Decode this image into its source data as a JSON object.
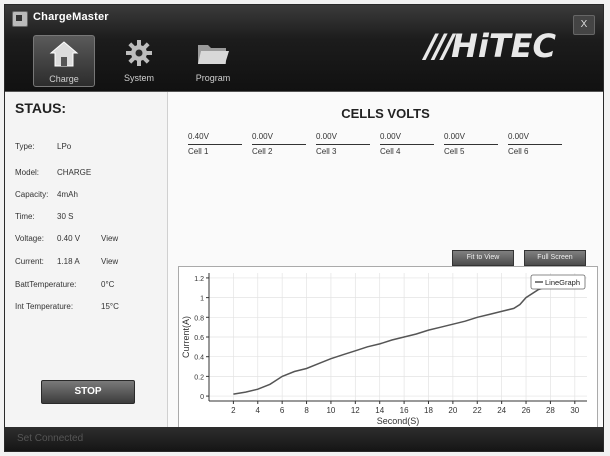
{
  "window": {
    "title": "ChargeMaster",
    "close_label": "X"
  },
  "toolbar": {
    "items": [
      {
        "label": "Charge",
        "icon": "house-icon"
      },
      {
        "label": "System",
        "icon": "gear-icon"
      },
      {
        "label": "Program",
        "icon": "folder-icon"
      }
    ]
  },
  "brand": {
    "logo_text": "HiTEC"
  },
  "status": {
    "heading": "STAUS:",
    "rows": [
      {
        "label": "Type:",
        "value": "LPo",
        "link": ""
      },
      {
        "label": "Model:",
        "value": "CHARGE",
        "link": ""
      },
      {
        "label": "Capacity:",
        "value": "4mAh",
        "link": ""
      },
      {
        "label": "Time:",
        "value": "30 S",
        "link": ""
      },
      {
        "label": "Voltage:",
        "value": "0.40 V",
        "link": "View"
      },
      {
        "label": "Current:",
        "value": "1.18 A",
        "link": "View"
      },
      {
        "label": "BattTemperature:",
        "value": "0°C",
        "link": ""
      },
      {
        "label": "Int Temperature:",
        "value": "15°C",
        "link": ""
      }
    ],
    "stop_label": "STOP"
  },
  "cells": {
    "title": "CELLS VOLTS",
    "items": [
      {
        "volt": "0.40V",
        "name": "Cell 1"
      },
      {
        "volt": "0.00V",
        "name": "Cell 2"
      },
      {
        "volt": "0.00V",
        "name": "Cell 3"
      },
      {
        "volt": "0.00V",
        "name": "Cell 4"
      },
      {
        "volt": "0.00V",
        "name": "Cell 5"
      },
      {
        "volt": "0.00V",
        "name": "Cell 6"
      }
    ]
  },
  "graph_buttons": {
    "fit_label": "Fit to View",
    "full_label": "Full Screen"
  },
  "chart_data": {
    "type": "line",
    "title": "",
    "xlabel": "Second(S)",
    "ylabel": "Current(A)",
    "xlim": [
      0,
      31
    ],
    "ylim": [
      -0.05,
      1.25
    ],
    "xticks": [
      2,
      4,
      6,
      8,
      10,
      12,
      14,
      16,
      18,
      20,
      22,
      24,
      26,
      28,
      30
    ],
    "yticks": [
      0,
      0.2,
      0.4,
      0.6,
      0.8,
      1,
      1.2
    ],
    "grid": true,
    "legend": "top-right",
    "series": [
      {
        "name": "LineGraph",
        "color": "#555555",
        "x": [
          2,
          3,
          4,
          5,
          6,
          7,
          8,
          9,
          10,
          11,
          12,
          13,
          14,
          15,
          16,
          17,
          18,
          19,
          20,
          21,
          22,
          23,
          24,
          25,
          25.5,
          26,
          27,
          28,
          29,
          30
        ],
        "y": [
          0.02,
          0.04,
          0.07,
          0.12,
          0.2,
          0.25,
          0.28,
          0.33,
          0.38,
          0.42,
          0.46,
          0.5,
          0.53,
          0.57,
          0.6,
          0.63,
          0.67,
          0.7,
          0.73,
          0.76,
          0.8,
          0.83,
          0.86,
          0.89,
          0.93,
          1.0,
          1.08,
          1.12,
          1.15,
          1.18
        ]
      }
    ]
  },
  "statusbar": {
    "text": "Set Connected"
  }
}
